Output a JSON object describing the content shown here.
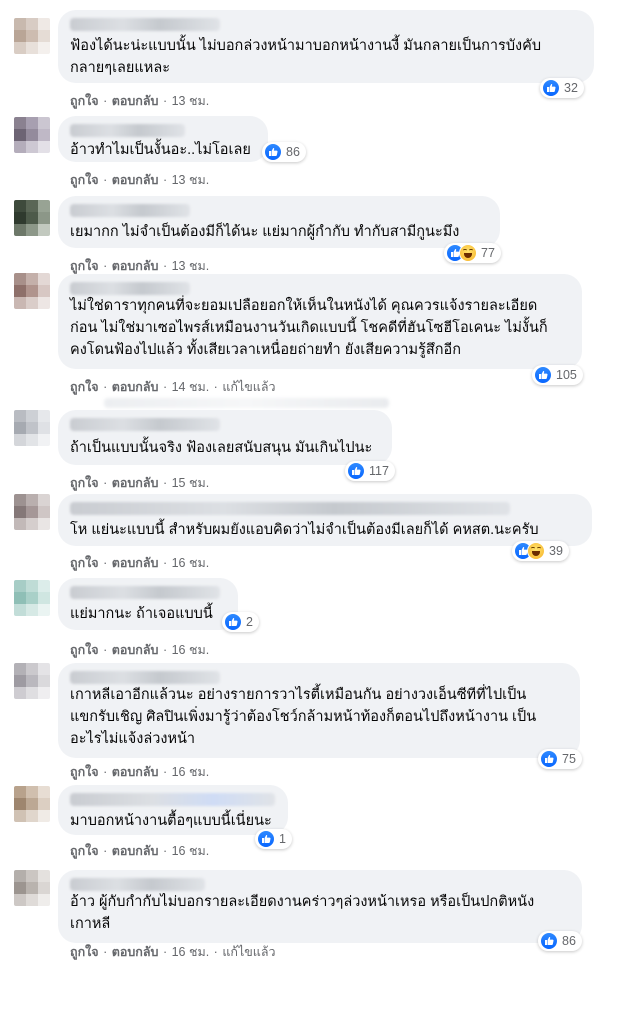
{
  "labels": {
    "like": "ถูกใจ",
    "reply": "ตอบกลับ",
    "separator": "·",
    "edited": "แก้ไขแล้ว"
  },
  "comments": [
    {
      "text": "ฟ้องได้นะน่ะแบบนั้น ไม่บอกล่วงหน้ามาบอกหน้างานงี้ มันกลายเป็นการบังคับ\nกลายๆเลยแหละ",
      "reactions": [
        "like"
      ],
      "reaction_count": "32",
      "time": "13 ชม.",
      "edited": false
    },
    {
      "text": "อ้าวทำไมเป็นงั้นอะ..ไม่โอเลย",
      "reactions": [
        "like"
      ],
      "reaction_count": "86",
      "time": "13 ชม.",
      "edited": false
    },
    {
      "text": "เยมากก ไม่จำเป็นต้องมีก็ได้นะ แย่มากผู้กำกับ ทำกับสามีกูนะมึง",
      "reactions": [
        "like",
        "haha"
      ],
      "reaction_count": "77",
      "time": "13 ชม.",
      "edited": false
    },
    {
      "text": "ไม่ใช่ดาราทุกคนที่จะยอมเปลือยอกให้เห็นในหนังได้ คุณควรแจ้งรายละเอียด\nก่อน ไม่ใช่มาเซอไพรส์เหมือนงานวันเกิดแบบนี้ โชคดีที่ฮันโซฮีโอเคนะ ไม่งั้นก็\nคงโดนฟ้องไปแล้ว ทั้งเสียเวลาเหนื่อยถ่ายทำ ยังเสียความรู้สึกอีก",
      "reactions": [
        "like"
      ],
      "reaction_count": "105",
      "time": "14 ชม.",
      "edited": true
    },
    {
      "text": "ถ้าเป็นแบบนั้นจริง ฟ้องเลยสนับสนุน มันเกินไปนะ",
      "reactions": [
        "like"
      ],
      "reaction_count": "117",
      "time": "15 ชม.",
      "edited": false
    },
    {
      "text": "โห แย่นะแบบนี้ สำหรับผมยังแอบคิดว่าไม่จำเป็นต้องมีเลยก็ได้ คหสต.นะครับ",
      "reactions": [
        "like",
        "haha"
      ],
      "reaction_count": "39",
      "time": "16 ชม.",
      "edited": false
    },
    {
      "text": "แย่มากนะ ถ้าเจอแบบนี้",
      "reactions": [
        "like"
      ],
      "reaction_count": "2",
      "time": "16 ชม.",
      "edited": false
    },
    {
      "text": "เกาหลีเอาอีกแล้วนะ อย่างรายการวาไรตี้เหมือนกัน อย่างวงเอ็นซีทีที่ไปเป็น\nแขกรับเชิญ ศิลปินเพิ่งมารู้ว่าต้องโชว์กล้ามหน้าท้องก็ตอนไปถึงหน้างาน เป็น\nอะไรไม่แจ้งล่วงหน้า",
      "reactions": [
        "like"
      ],
      "reaction_count": "75",
      "time": "16 ชม.",
      "edited": false
    },
    {
      "text": "มาบอกหน้างานตื้อๆแบบนี้เนี่ยนะ",
      "reactions": [
        "like"
      ],
      "reaction_count": "1",
      "time": "16 ชม.",
      "edited": false
    },
    {
      "text": "อ้าว ผู้กับกำกับไม่บอกรายละเอียดงานคร่าวๆล่วงหน้าเหรอ หรือเป็นปกติหนัง\nเกาหลี",
      "reactions": [
        "like"
      ],
      "reaction_count": "86",
      "time": "16 ชม.",
      "edited": true
    }
  ]
}
